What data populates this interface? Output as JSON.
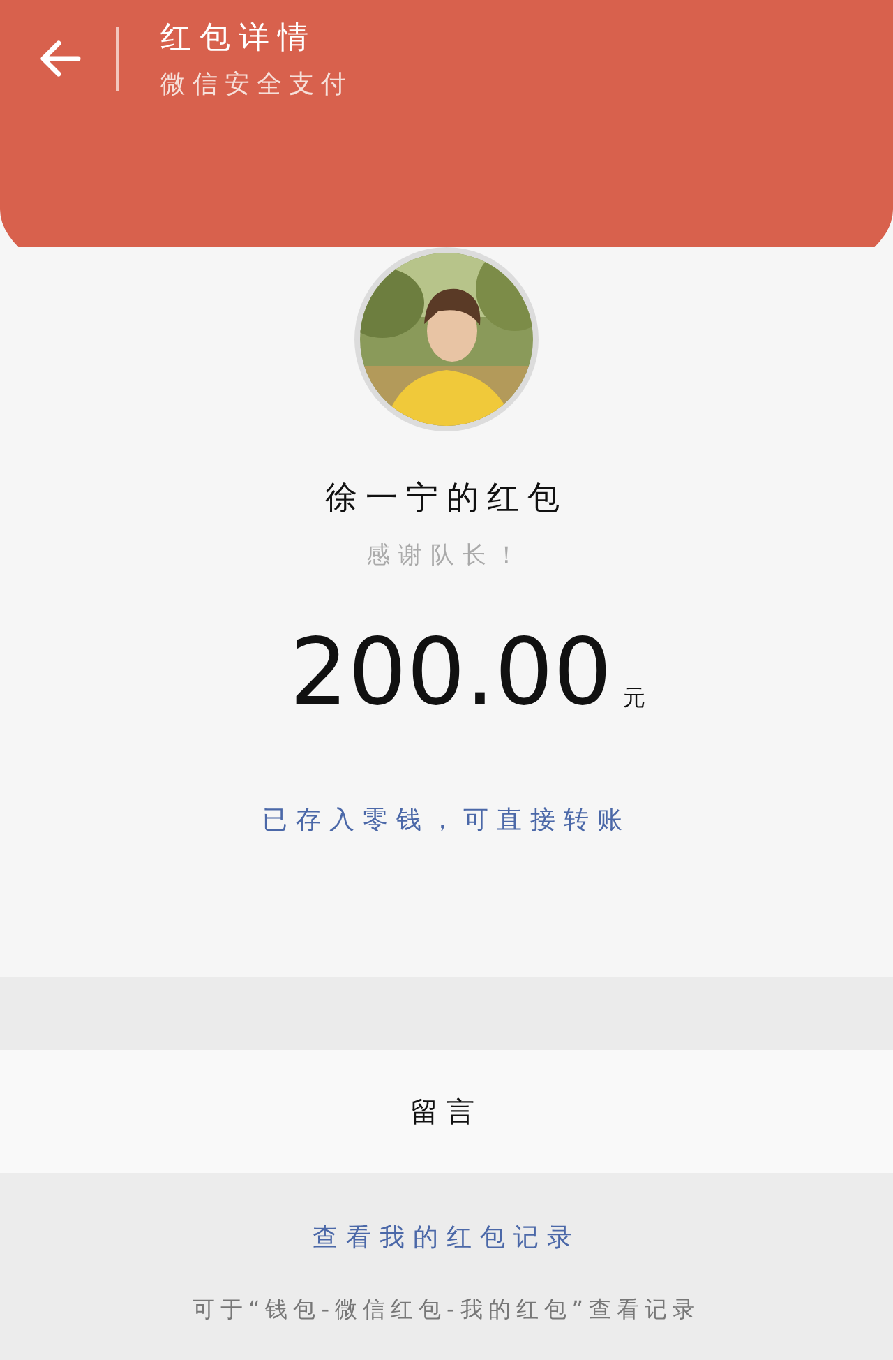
{
  "header": {
    "title": "红包详情",
    "subtitle": "微信安全支付"
  },
  "packet": {
    "sender_title": "徐一宁的红包",
    "greeting": "感谢队长！",
    "amount": "200.00",
    "currency": "元",
    "status_link": "已存入零钱，可直接转账"
  },
  "message_row": {
    "label": "留言"
  },
  "footer": {
    "records_link": "查看我的红包记录",
    "hint": "可于“钱包-微信红包-我的红包”查看记录"
  }
}
